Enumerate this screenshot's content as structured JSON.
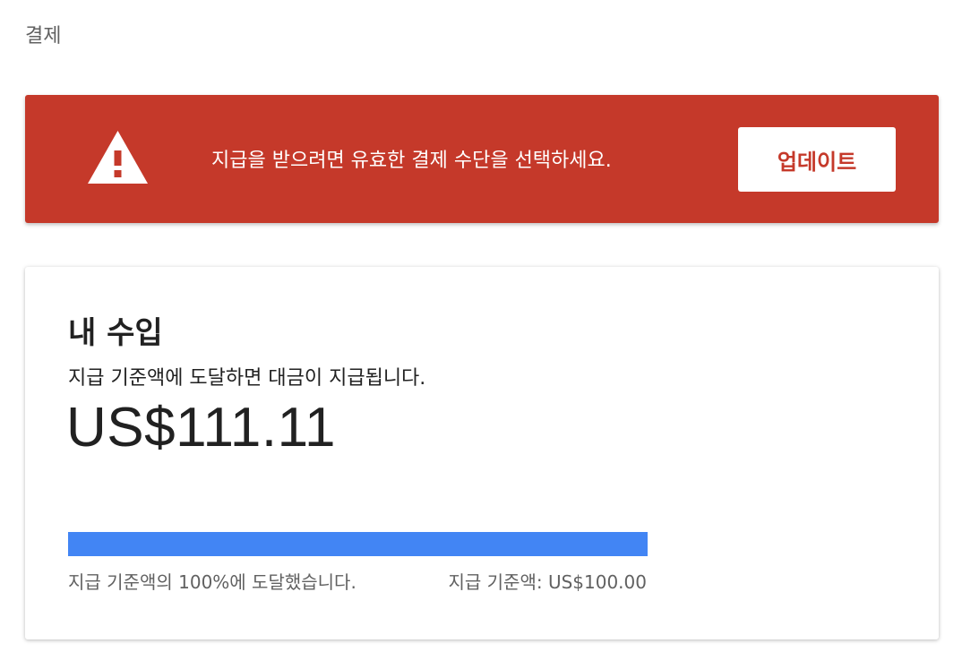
{
  "page": {
    "title": "결제"
  },
  "alert": {
    "message": "지급을 받으려면 유효한 결제 수단을 선택하세요.",
    "button_label": "업데이트",
    "icon": "warning-icon",
    "color": "#c5392a"
  },
  "earnings": {
    "title": "내 수입",
    "subtitle": "지급 기준액에 도달하면 대금이 지급됩니다.",
    "balance": "US$111.11",
    "progress_percent": 100,
    "progress_color": "#4285f4",
    "progress_label": "지급 기준액의 100%에 도달했습니다.",
    "threshold_label": "지급 기준액: US$100.00"
  }
}
